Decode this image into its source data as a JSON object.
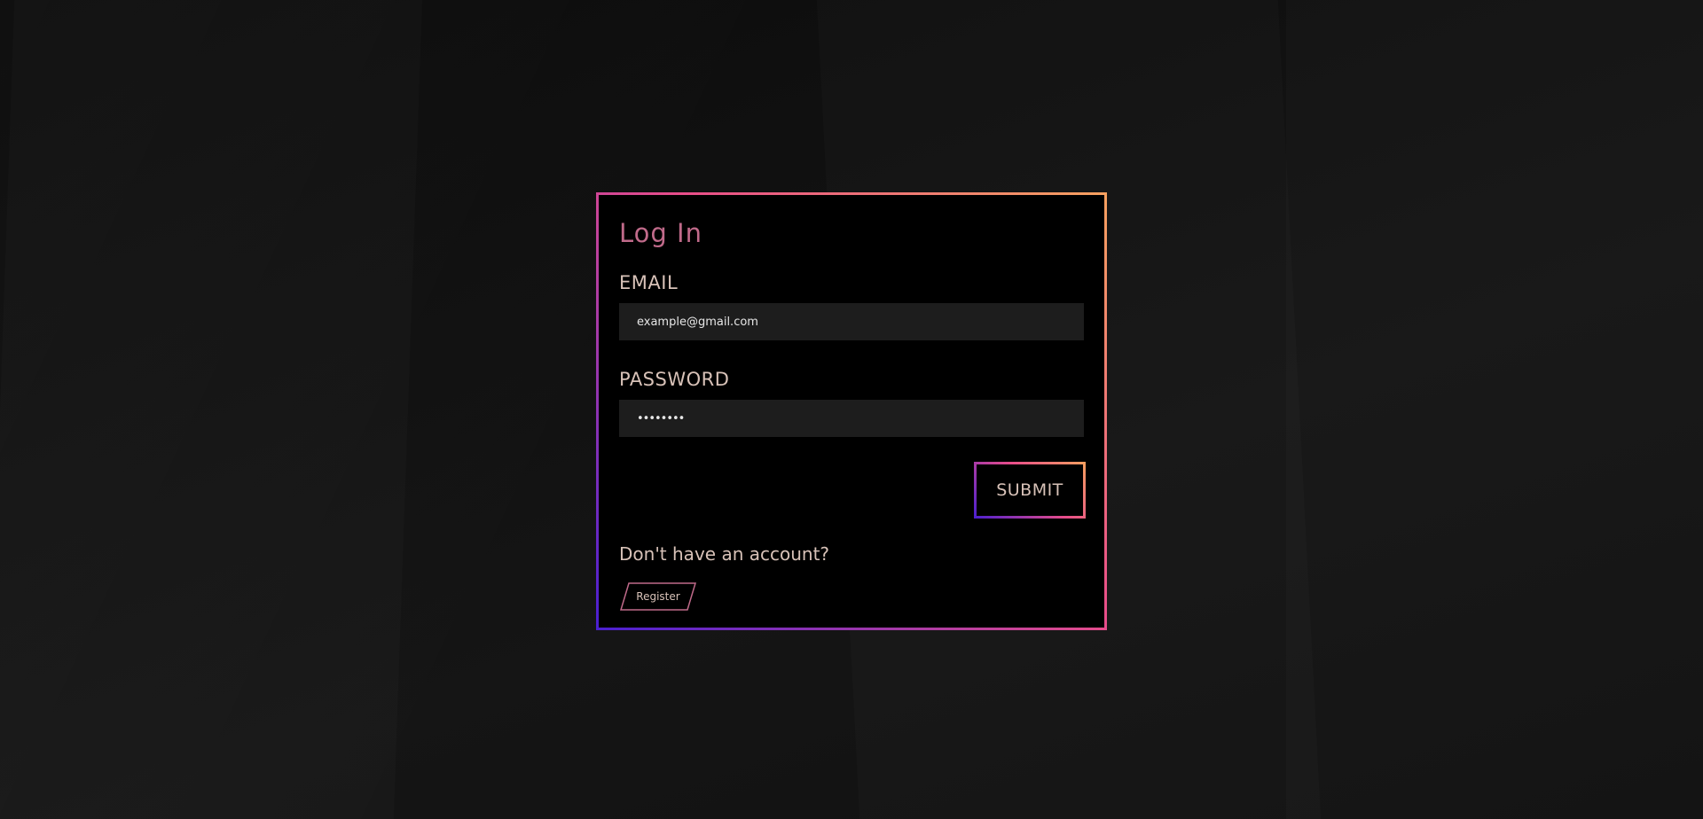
{
  "login": {
    "title": "Log In",
    "email_label": "EMAIL",
    "email_value": "example@gmail.com",
    "password_label": "PASSWORD",
    "password_value": "password",
    "submit_label": "SUBMIT",
    "account_prompt": "Don't have an account?",
    "register_label": "Register"
  },
  "colors": {
    "background": "#0f0f0f",
    "card": "#000000",
    "accent_pink": "#e84d8a",
    "accent_orange": "#f6a15f",
    "accent_purple": "#4a1fd1",
    "title": "#c06a8a",
    "label": "#d8c2b8",
    "input_bg": "#1d1d1d"
  }
}
